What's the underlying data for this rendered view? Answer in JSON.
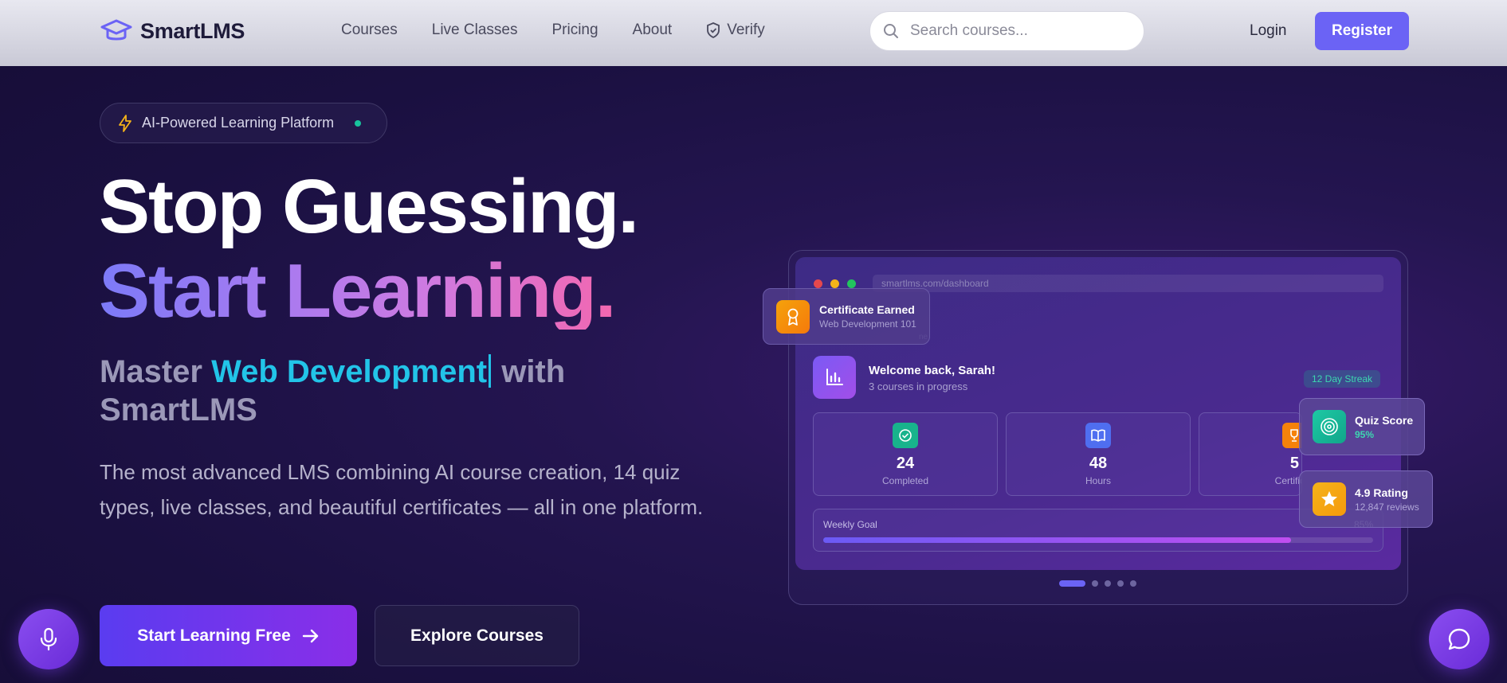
{
  "nav": {
    "brand": "SmartLMS",
    "links": [
      "Courses",
      "Live Classes",
      "Pricing",
      "About",
      "Verify"
    ],
    "search_placeholder": "Search courses...",
    "login": "Login",
    "register": "Register"
  },
  "hero": {
    "badge": "AI-Powered Learning Platform",
    "headline_1": "Stop Guessing.",
    "headline_2": "Start Learning.",
    "sub_prefix": "Master",
    "sub_accent": "Web Development",
    "sub_suffix": "with",
    "sub_brand": "SmartLMS",
    "description": "The most advanced LMS combining AI course creation, 14 quiz types, live classes, and beautiful certificates — all in one platform.",
    "cta_primary": "Start Learning Free",
    "cta_secondary": "Explore Courses"
  },
  "dashboard": {
    "url": "smartlms.com/dashboard",
    "bg_fragment": "ne",
    "cert_title": "Certificate Earned",
    "cert_sub": "Web Development 101",
    "welcome_title": "Welcome back, Sarah!",
    "welcome_sub": "3 courses in progress",
    "streak": "12 Day Streak",
    "stats": [
      {
        "value": "24",
        "label": "Completed"
      },
      {
        "value": "48",
        "label": "Hours"
      },
      {
        "value": "5",
        "label": "Certific"
      }
    ],
    "goal_label": "Weekly Goal",
    "goal_pct_text": "85%",
    "goal_progress": 0.85,
    "quiz_title": "Quiz Score",
    "quiz_value": "95%",
    "rating_title": "4.9 Rating",
    "rating_sub": "12,847 reviews",
    "pager_active_index": 0,
    "pager_count": 5
  },
  "colors": {
    "accent": "#6b63f5",
    "cyan": "#22c4e8",
    "green": "#18c29c",
    "orange": "#f59e0b"
  }
}
